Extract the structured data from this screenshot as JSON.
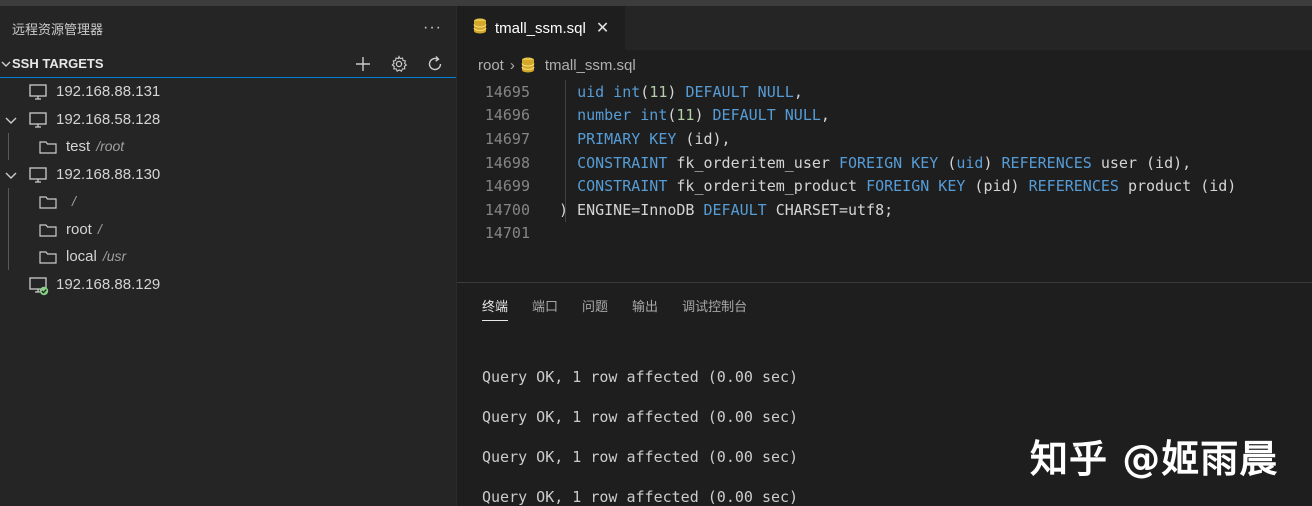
{
  "sidebar": {
    "title": "远程资源管理器",
    "more": "···",
    "section": {
      "title": "SSH TARGETS",
      "actions": [
        "add-icon",
        "gear-icon",
        "refresh-icon"
      ]
    },
    "items": [
      {
        "label": "192.168.88.131",
        "sub": "",
        "icon": "monitor-icon",
        "level": 0,
        "chevron": ""
      },
      {
        "label": "192.168.58.128",
        "sub": "",
        "icon": "monitor-icon",
        "level": 0,
        "chevron": "down"
      },
      {
        "label": "test",
        "sub": "/root",
        "icon": "folder-icon",
        "level": 1,
        "chevron": ""
      },
      {
        "label": "192.168.88.130",
        "sub": "",
        "icon": "monitor-icon",
        "level": 0,
        "chevron": "down"
      },
      {
        "label": "",
        "sub": "/",
        "icon": "folder-icon",
        "level": 1,
        "chevron": ""
      },
      {
        "label": "root",
        "sub": "/",
        "icon": "folder-icon",
        "level": 1,
        "chevron": ""
      },
      {
        "label": "local",
        "sub": "/usr",
        "icon": "folder-icon",
        "level": 1,
        "chevron": ""
      },
      {
        "label": "192.168.88.129",
        "sub": "",
        "icon": "monitor-connected-icon",
        "level": 0,
        "chevron": ""
      }
    ]
  },
  "editor": {
    "tab": {
      "label": "tmall_ssm.sql",
      "close": "✕"
    },
    "breadcrumb": {
      "root": "root",
      "sep": "›",
      "file": "tmall_ssm.sql"
    },
    "lines": [
      {
        "n": "14695",
        "parts": [
          [
            "t",
            "  "
          ],
          [
            "kw",
            "uid int"
          ],
          [
            "t",
            "("
          ],
          [
            "num",
            "11"
          ],
          [
            "t",
            ") "
          ],
          [
            "kw",
            "DEFAULT NULL"
          ],
          [
            "t",
            ","
          ]
        ]
      },
      {
        "n": "14696",
        "parts": [
          [
            "t",
            "  "
          ],
          [
            "kw",
            "number int"
          ],
          [
            "t",
            "("
          ],
          [
            "num",
            "11"
          ],
          [
            "t",
            ") "
          ],
          [
            "kw",
            "DEFAULT NULL"
          ],
          [
            "t",
            ","
          ]
        ]
      },
      {
        "n": "14697",
        "parts": [
          [
            "t",
            "  "
          ],
          [
            "kw",
            "PRIMARY KEY"
          ],
          [
            "t",
            " (id),"
          ]
        ]
      },
      {
        "n": "14698",
        "parts": [
          [
            "t",
            "  "
          ],
          [
            "kw",
            "CONSTRAINT"
          ],
          [
            "t",
            " fk_orderitem_user "
          ],
          [
            "kw",
            "FOREIGN KEY"
          ],
          [
            "t",
            " ("
          ],
          [
            "kw",
            "uid"
          ],
          [
            "t",
            ") "
          ],
          [
            "kw",
            "REFERENCES"
          ],
          [
            "t",
            " user (id),"
          ]
        ]
      },
      {
        "n": "14699",
        "parts": [
          [
            "t",
            "  "
          ],
          [
            "kw",
            "CONSTRAINT"
          ],
          [
            "t",
            " fk_orderitem_product "
          ],
          [
            "kw",
            "FOREIGN KEY"
          ],
          [
            "t",
            " (pid) "
          ],
          [
            "kw",
            "REFERENCES"
          ],
          [
            "t",
            " product (id)"
          ]
        ]
      },
      {
        "n": "14700",
        "parts": [
          [
            "t",
            ") ENGINE=InnoDB "
          ],
          [
            "kw",
            "DEFAULT"
          ],
          [
            "t",
            " CHARSET=utf8;"
          ]
        ]
      },
      {
        "n": "14701",
        "parts": []
      }
    ]
  },
  "panel": {
    "tabs": [
      "终端",
      "端口",
      "问题",
      "输出",
      "调试控制台"
    ],
    "active": 0,
    "terminal": [
      "Query OK, 1 row affected (0.00 sec)",
      "Query OK, 1 row affected (0.00 sec)",
      "Query OK, 1 row affected (0.00 sec)",
      "Query OK, 1 row affected (0.00 sec)"
    ]
  },
  "watermark": "知乎 @姬雨晨"
}
